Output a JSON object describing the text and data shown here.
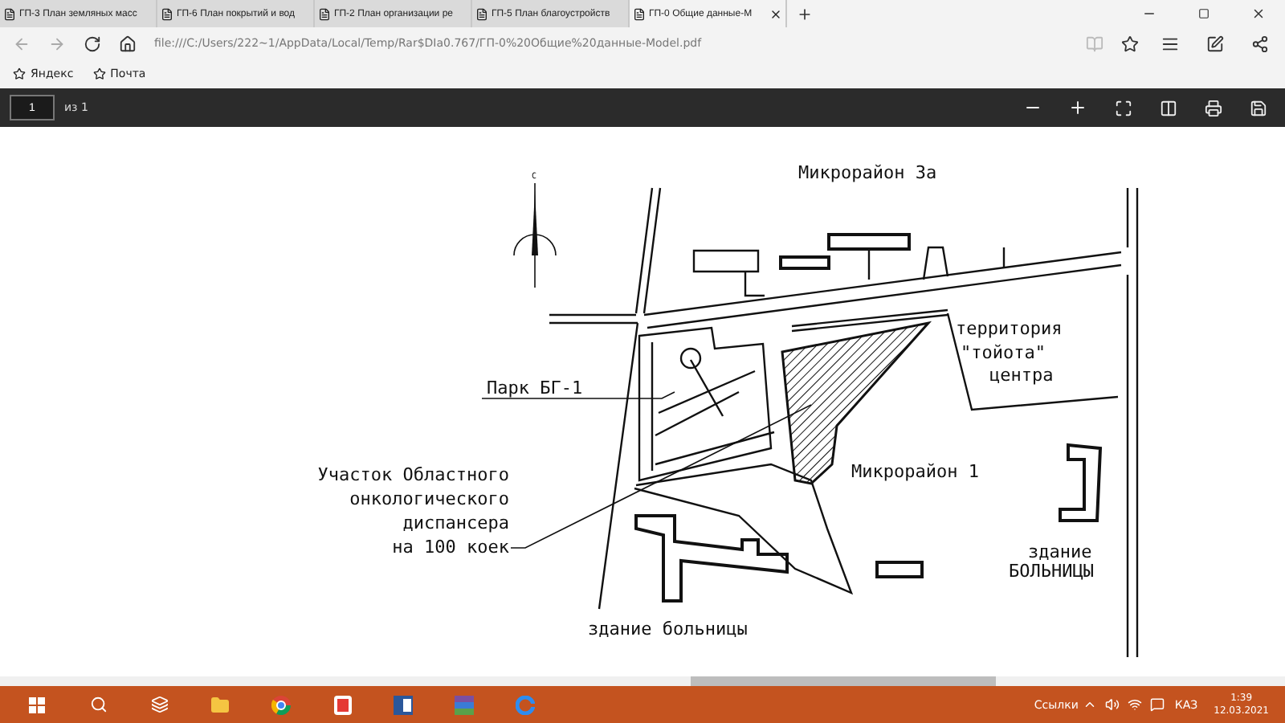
{
  "browser": {
    "tabs": [
      {
        "label": "ГП-3 План земляных масс",
        "selected": false
      },
      {
        "label": "ГП-6 План покрытий и вод",
        "selected": false
      },
      {
        "label": "ГП-2 План организации ре",
        "selected": false
      },
      {
        "label": "ГП-5 План благоустройств",
        "selected": false
      },
      {
        "label": "ГП-0 Общие данные-М",
        "selected": true
      }
    ],
    "address": "file:///C:/Users/222~1/AppData/Local/Temp/Rar$DIa0.767/ГП-0%20Общие%20данные-Model.pdf",
    "favorites": [
      "Яндекс",
      "Почта"
    ]
  },
  "pdf_toolbar": {
    "page": "1",
    "page_count": "из 1"
  },
  "drawing": {
    "labels": [
      {
        "kind": "plain",
        "text": "С"
      },
      {
        "kind": "plain",
        "text": "Микрорайон 3а"
      },
      {
        "kind": "plain",
        "text": "территория"
      },
      {
        "kind": "plain",
        "text": "\"тойота\""
      },
      {
        "kind": "plain",
        "text": "центра"
      },
      {
        "kind": "leader",
        "text": "Парк БГ-1"
      },
      {
        "kind": "right",
        "text": "Участок Областного"
      },
      {
        "kind": "plain",
        "text": "Микрорайон 1"
      },
      {
        "kind": "right",
        "text": "онкологического"
      },
      {
        "kind": "right",
        "text": "диспансера"
      },
      {
        "kind": "leader",
        "text": "на 100 коек"
      },
      {
        "kind": "plain",
        "text": "здание"
      },
      {
        "kind": "plain",
        "text": "БОЛЬНИЦЫ"
      },
      {
        "kind": "plain",
        "text": "здание больницы"
      }
    ]
  },
  "taskbar": {
    "links": "Ссылки",
    "language": "КАЗ",
    "time": "1:39",
    "date": "12.03.2021"
  }
}
